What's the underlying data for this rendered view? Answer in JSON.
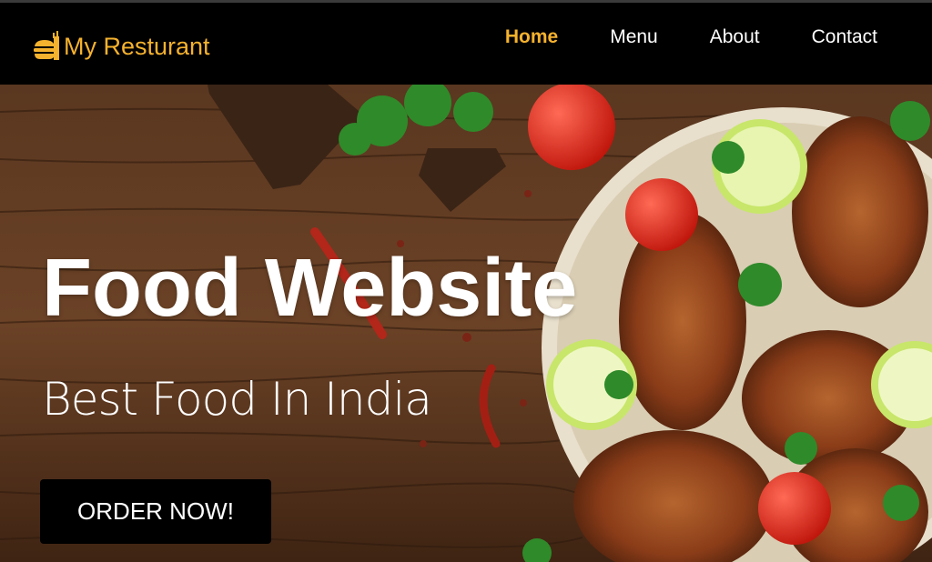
{
  "header": {
    "brand": "My Resturant",
    "brand_icon": "burger-icon",
    "brand_color": "#f5b22e",
    "nav": [
      {
        "label": "Home",
        "active": true
      },
      {
        "label": "Menu",
        "active": false
      },
      {
        "label": "About",
        "active": false
      },
      {
        "label": "Contact",
        "active": false
      }
    ]
  },
  "hero": {
    "title": "Food Website",
    "subtitle": "Best Food In India",
    "cta_label": "ORDER NOW!",
    "image": "grilled-chicken-on-wooden-table"
  }
}
